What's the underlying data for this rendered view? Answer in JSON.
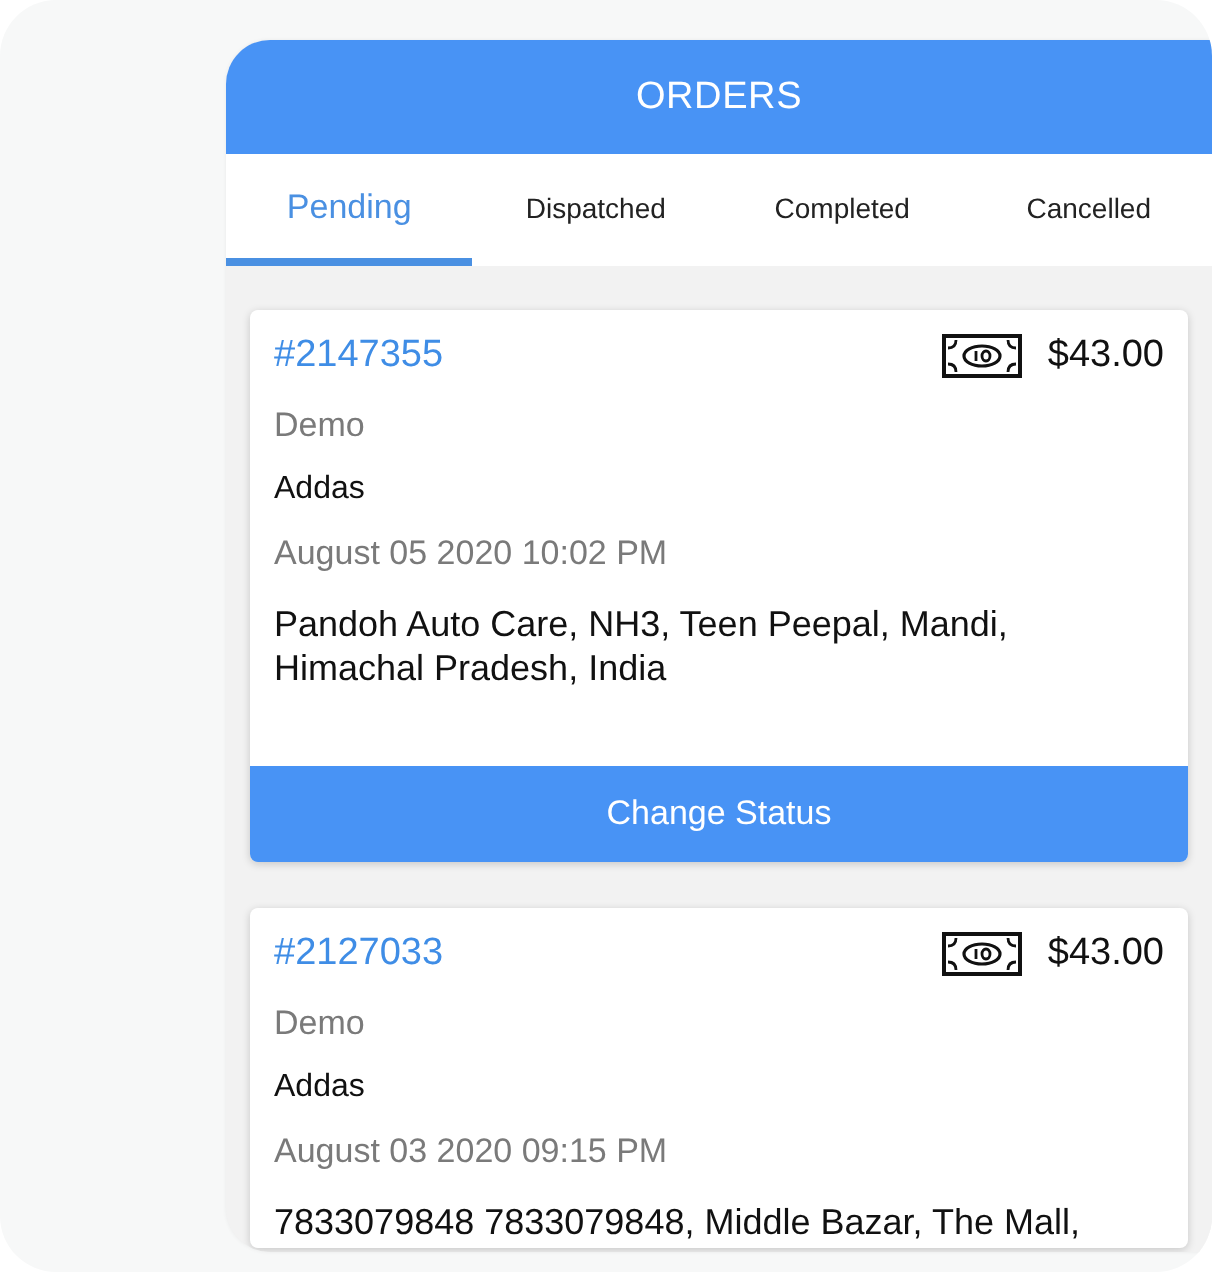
{
  "header": {
    "title": "ORDERS"
  },
  "tabs": [
    {
      "label": "Pending",
      "selected": true
    },
    {
      "label": "Dispatched",
      "selected": false
    },
    {
      "label": "Completed",
      "selected": false
    },
    {
      "label": "Cancelled",
      "selected": false
    }
  ],
  "orders": [
    {
      "order_number": "#2147355",
      "amount": "$43.00",
      "customer": "Demo",
      "store": "Addas",
      "date": "August 05 2020 10:02 PM",
      "address": "Pandoh Auto Care, NH3, Teen Peepal, Mandi, Himachal Pradesh, India",
      "button": "Change Status"
    },
    {
      "order_number": "#2127033",
      "amount": "$43.00",
      "customer": "Demo",
      "store": "Addas",
      "date": "August 03 2020 09:15 PM",
      "address": "7833079848 7833079848, Middle Bazar, The Mall,"
    }
  ]
}
